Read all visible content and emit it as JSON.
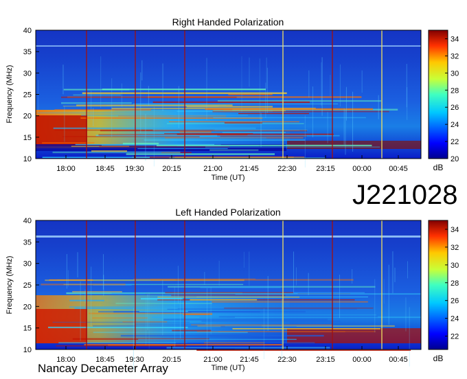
{
  "observation_id": "J221028",
  "instrument": "Nancay Decameter Array",
  "chart_data": [
    {
      "type": "heatmap",
      "title": "Right Handed Polarization",
      "xlabel": "Time (UT)",
      "ylabel": "Frequency (MHz)",
      "x_ticks": [
        "18:00",
        "18:45",
        "19:30",
        "20:15",
        "21:00",
        "21:45",
        "22:30",
        "23:15",
        "00:00",
        "00:45"
      ],
      "y_ticks": [
        10,
        15,
        20,
        25,
        30,
        35,
        40
      ],
      "ylim": [
        10,
        40
      ],
      "colorbar": {
        "label": "dB",
        "ticks": [
          20,
          22,
          24,
          26,
          28,
          30,
          32,
          34
        ],
        "range": [
          20,
          35
        ]
      },
      "vertical_markers": [
        "dark-red",
        "dark-red",
        "dark-red",
        "yellow",
        "dark-red",
        "yellow"
      ]
    },
    {
      "type": "heatmap",
      "title": "Left Handed Polarization",
      "xlabel": "Time (UT)",
      "ylabel": "Frequency (MHz)",
      "x_ticks": [
        "18:00",
        "18:45",
        "19:30",
        "20:15",
        "21:00",
        "21:45",
        "22:30",
        "23:15",
        "00:00",
        "00:45"
      ],
      "y_ticks": [
        10,
        15,
        20,
        25,
        30,
        35,
        40
      ],
      "ylim": [
        10,
        40
      ],
      "colorbar": {
        "label": "dB",
        "ticks": [
          22,
          24,
          26,
          28,
          30,
          32,
          34
        ],
        "range": [
          20.5,
          35
        ]
      },
      "vertical_markers": [
        "dark-red",
        "dark-red",
        "dark-red",
        "yellow",
        "dark-red",
        "yellow"
      ]
    }
  ]
}
